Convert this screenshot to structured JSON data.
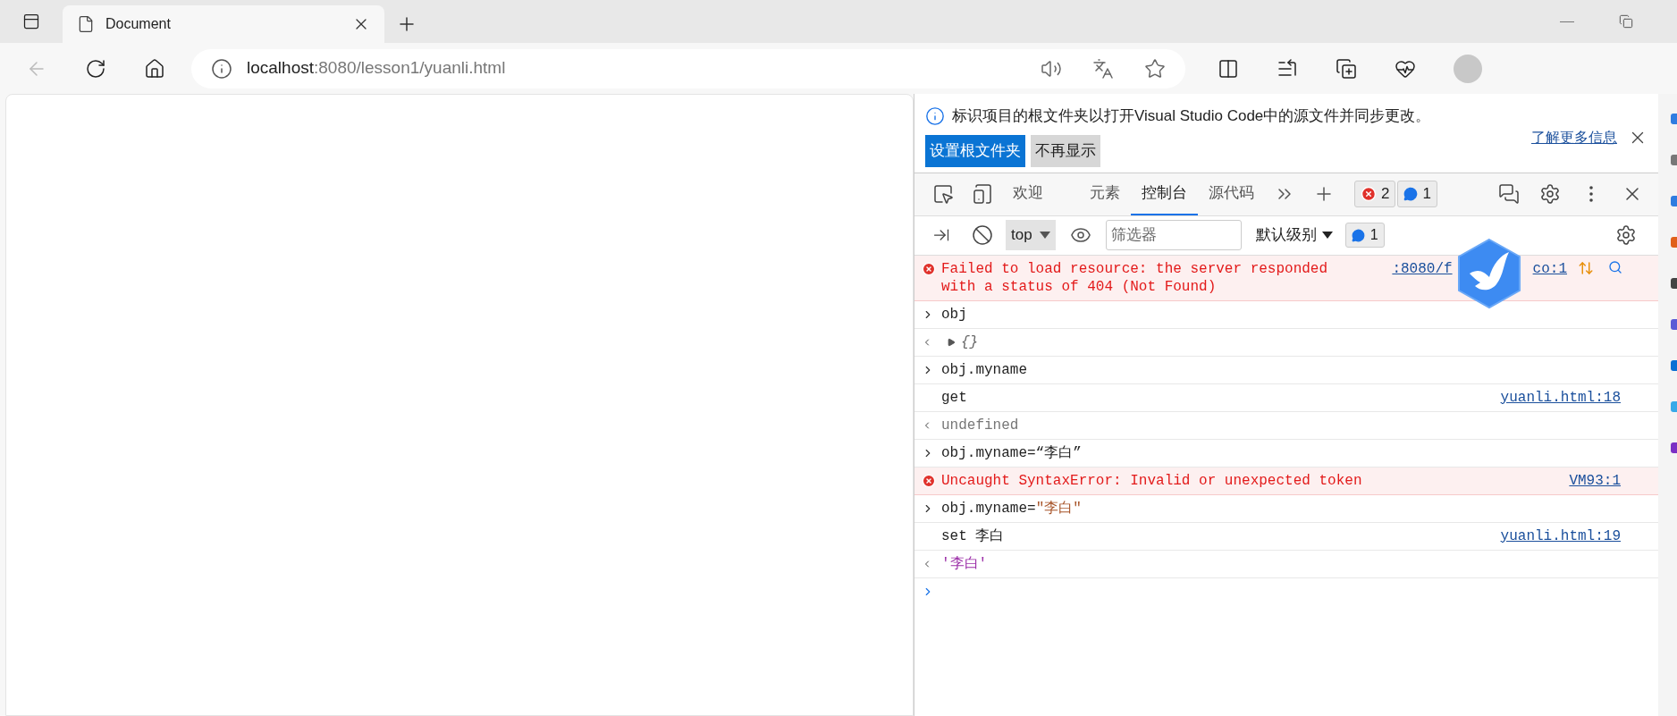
{
  "browser": {
    "tabs": [
      {
        "title": "Document",
        "selected": true
      }
    ],
    "address": {
      "host": "localhost",
      "path": ":8080/lesson1/yuanli.html"
    }
  },
  "devtools": {
    "infobar": {
      "message": "标识项目的根文件夹以打开Visual Studio Code中的源文件并同步更改。",
      "link": "了解更多信息",
      "buttons": [
        {
          "label": "设置根文件夹",
          "kind": "primary"
        },
        {
          "label": "不再显示",
          "kind": "secondary"
        }
      ]
    },
    "tabs": [
      {
        "label": "欢迎",
        "selected": false
      },
      {
        "label": "元素",
        "selected": false
      },
      {
        "label": "控制台",
        "selected": true
      },
      {
        "label": "源代码",
        "selected": false
      }
    ],
    "error_count": "2",
    "message_count": "1",
    "console_toolbar": {
      "context": "top",
      "filter_placeholder": "筛选器",
      "level": "默认级别",
      "message_count": "1"
    },
    "console": [
      {
        "kind": "error",
        "text": "Failed to load resource: the server responded with a status of 404 (Not Found)",
        "source_start": ":8080/f",
        "source_end": "co:1"
      },
      {
        "kind": "input",
        "text": "obj"
      },
      {
        "kind": "object",
        "text": "{}"
      },
      {
        "kind": "input",
        "text": "obj.myname"
      },
      {
        "kind": "log",
        "text": "get",
        "source": "yuanli.html:18"
      },
      {
        "kind": "undefined",
        "text": "undefined"
      },
      {
        "kind": "input",
        "text": "obj.myname=“李白”"
      },
      {
        "kind": "error",
        "text": "Uncaught SyntaxError: Invalid or unexpected token",
        "source": "VM93:1"
      },
      {
        "kind": "input",
        "text": "obj.myname=",
        "string": "\"李白\""
      },
      {
        "kind": "log",
        "text": "set 李白",
        "source": "yuanli.html:19"
      },
      {
        "kind": "string",
        "text": "'李白'"
      },
      {
        "kind": "prompt"
      }
    ]
  }
}
